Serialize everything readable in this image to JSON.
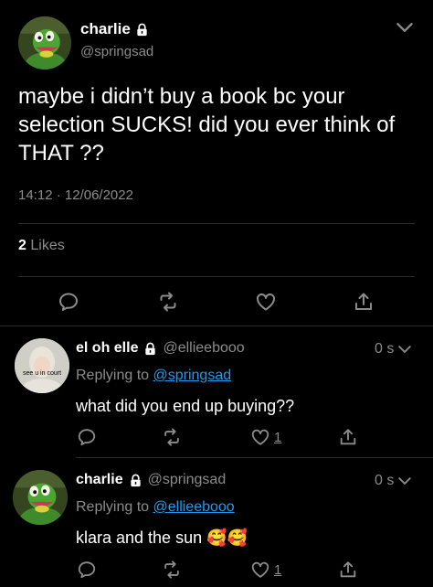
{
  "main_tweet": {
    "author_name": "charlie",
    "handle": "@springsad",
    "text": "maybe i didn’t buy a book bc your selection SUCKS! did you ever think of THAT ??",
    "time": "14:12",
    "separator": "·",
    "date": "12/06/2022",
    "likes_count": "2",
    "likes_label": "Likes"
  },
  "replies": [
    {
      "author_name": "el oh elle",
      "handle": "@ellieebooo",
      "time": "0 s",
      "replying_prefix": "Replying to",
      "replying_to": "@springsad",
      "text": "what did you end up buying??",
      "avatar_caption": "see u in court",
      "like_count": "1"
    },
    {
      "author_name": "charlie",
      "handle": "@springsad",
      "time": "0 s",
      "replying_prefix": "Replying to",
      "replying_to": "@ellieebooo",
      "text": "klara and the sun",
      "emoji": "🥰🥰",
      "like_count": "1"
    }
  ],
  "colors": {
    "background": "#000000",
    "muted": "#8b8b8b",
    "link": "#1d9bf0",
    "divider": "#2a2a2a"
  },
  "icons": [
    "lock-icon",
    "chevron-down-icon",
    "reply-icon",
    "retweet-icon",
    "heart-icon",
    "share-icon"
  ]
}
